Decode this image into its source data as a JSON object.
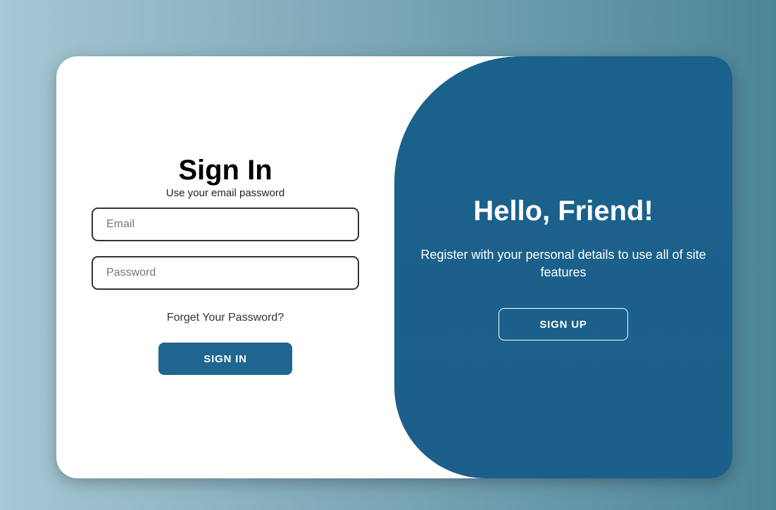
{
  "signin": {
    "title": "Sign In",
    "subtitle": "Use your email password",
    "email_placeholder": "Email",
    "email_value": "",
    "password_placeholder": "Password",
    "password_value": "",
    "forgot_label": "Forget Your Password?",
    "button_label": "SIGN IN"
  },
  "welcome": {
    "title": "Hello, Friend!",
    "message": "Register with your personal details to use all of site features",
    "button_label": "SIGN UP"
  },
  "colors": {
    "accent": "#1f6690",
    "panel": "#1a628c",
    "card": "#ffffff"
  }
}
